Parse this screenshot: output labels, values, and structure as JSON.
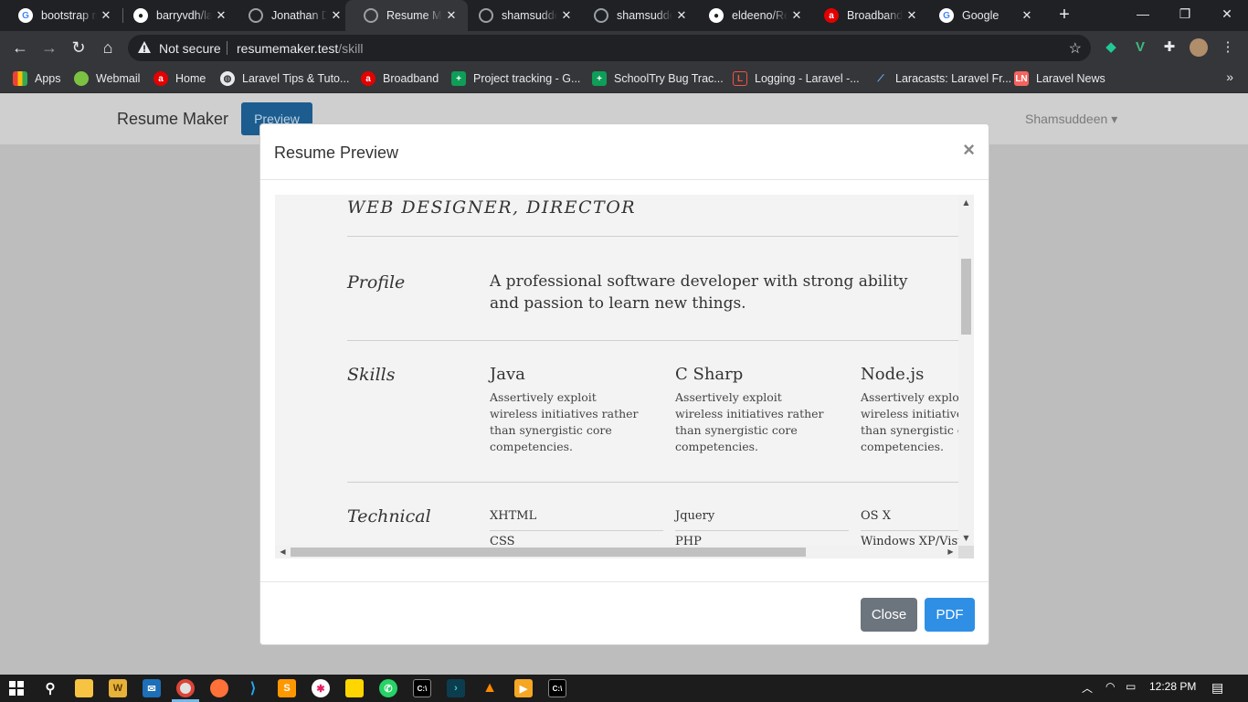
{
  "browser": {
    "tabs": [
      {
        "title": "bootstrap m",
        "favicon": "google-icon",
        "color": "#ffffff"
      },
      {
        "title": "barryvdh/la",
        "favicon": "github-icon",
        "color": "#ffffff"
      },
      {
        "title": "Jonathan D",
        "favicon": "globe-icon",
        "color": "#9aa0a6"
      },
      {
        "title": "Resume Ma",
        "favicon": "globe-icon",
        "color": "#9aa0a6",
        "active": true
      },
      {
        "title": "shamsudde",
        "favicon": "globe-icon",
        "color": "#9aa0a6"
      },
      {
        "title": "shamsudde",
        "favicon": "globe-icon",
        "color": "#9aa0a6"
      },
      {
        "title": "eldeeno/Re",
        "favicon": "github-icon",
        "color": "#ffffff"
      },
      {
        "title": "Broadband",
        "favicon": "airtel-icon",
        "color": "#e40000"
      },
      {
        "title": "Google",
        "favicon": "google-icon",
        "color": "#ffffff"
      }
    ],
    "omnibox": {
      "security": "Not secure",
      "host": "resumemaker.test",
      "path": "/skill"
    },
    "bookmarks": [
      {
        "label": "Apps",
        "icon": "apps-grid-icon"
      },
      {
        "label": "Webmail",
        "icon": "webmail-icon"
      },
      {
        "label": "Home",
        "icon": "airtel-icon"
      },
      {
        "label": "Laravel Tips & Tuto...",
        "icon": "globe-icon"
      },
      {
        "label": "Broadband",
        "icon": "airtel-icon"
      },
      {
        "label": "Project tracking - G...",
        "icon": "sheets-icon"
      },
      {
        "label": "SchoolTry Bug Trac...",
        "icon": "sheets-icon"
      },
      {
        "label": "Logging - Laravel -...",
        "icon": "laravel-icon"
      },
      {
        "label": "Laracasts: Laravel Fr...",
        "icon": "laracasts-icon"
      },
      {
        "label": "Laravel News",
        "icon": "laravel-news-icon"
      }
    ]
  },
  "app": {
    "brand": "Resume Maker",
    "preview_button": "Preview",
    "user": "Shamsuddeen"
  },
  "modal": {
    "title": "Resume Preview",
    "close_x": "×",
    "buttons": {
      "close": "Close",
      "pdf": "PDF"
    }
  },
  "resume": {
    "job_title": "WEB DESIGNER, DIRECTOR",
    "profile": {
      "label": "Profile",
      "text": "A professional software developer with strong ability and passion to learn new things."
    },
    "skills": {
      "label": "Skills",
      "items": [
        {
          "name": "Java",
          "desc": "Assertively exploit wireless initiatives rather than synergistic core competencies."
        },
        {
          "name": "C Sharp",
          "desc": "Assertively exploit wireless initiatives rather than synergistic core competencies."
        },
        {
          "name": "Node.js",
          "desc": "Assertively exploit wireless initiatives rather than synergistic core competencies."
        }
      ]
    },
    "technical": {
      "label": "Technical",
      "columns": [
        [
          "XHTML",
          "CSS"
        ],
        [
          "Jquery",
          "PHP"
        ],
        [
          "OS X",
          "Windows XP/Vista"
        ]
      ]
    }
  },
  "taskbar": {
    "time": "12:28 PM"
  }
}
